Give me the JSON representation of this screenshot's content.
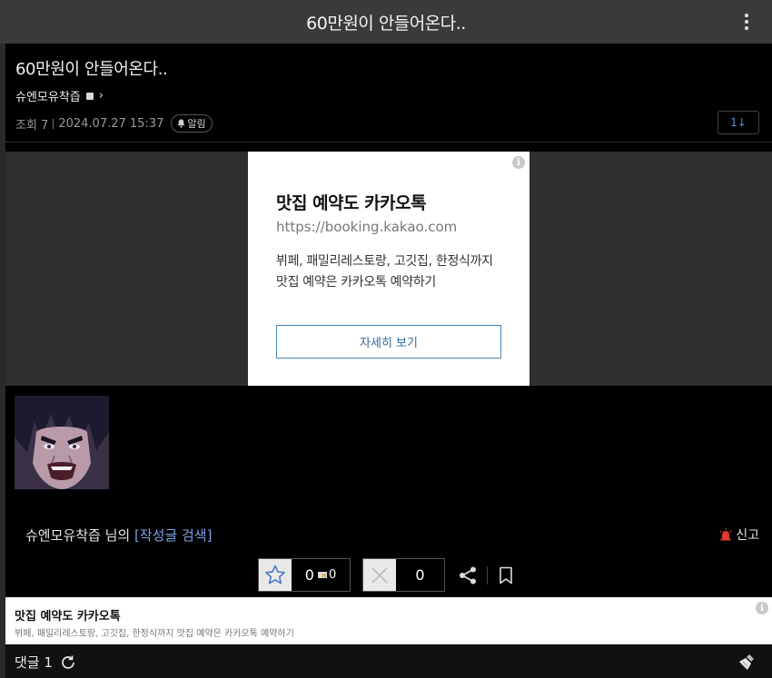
{
  "topbar": {
    "title": "60만원이 안들어온다..",
    "menu_icon": "more-vertical-icon"
  },
  "post": {
    "title": "60만원이 안들어온다..",
    "author": "슈엔모유착즙",
    "views_label": "조회 7",
    "date": "2024.07.27 15:37",
    "alarm_label": "알림",
    "page_label": "1↓"
  },
  "ad_card": {
    "title": "맛집 예약도 카카오톡",
    "url": "https://booking.kakao.com",
    "desc": "뷔페, 패밀리레스토랑, 고깃집, 한정식까지 맛집 예약은 카카오톡 예약하기",
    "button": "자세히 보기",
    "info": "i"
  },
  "byline": {
    "author": "슈엔모유착즙",
    "suffix": " 님의 ",
    "search_link": "[작성글 검색]"
  },
  "report": {
    "label": "신고",
    "color": "#e03a2f"
  },
  "votes": {
    "up": "0",
    "up_fixed": "0",
    "down": "0"
  },
  "bottom_ad": {
    "title": "맛집 예약도 카카오톡",
    "desc": "뷔페, 패밀리레스토랑, 고깃집, 한정식까지 맛집 예약은 카카오톡 예약하기",
    "info": "i"
  },
  "comments": {
    "label": "댓글 1"
  },
  "colors": {
    "accent_link": "#7aa2e8",
    "page_btn": "#5b8fd9",
    "ad_button": "#2c6aa0"
  }
}
